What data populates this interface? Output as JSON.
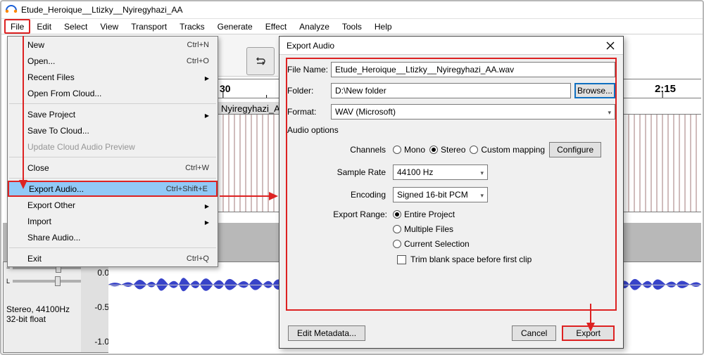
{
  "window_title": "Etude_Heroique__Ltizky__Nyiregyhazi_AA",
  "menubar": [
    "File",
    "Edit",
    "Select",
    "View",
    "Transport",
    "Tracks",
    "Generate",
    "Effect",
    "Analyze",
    "Tools",
    "Help"
  ],
  "file_menu": {
    "new": {
      "label": "New",
      "shortcut": "Ctrl+N"
    },
    "open": {
      "label": "Open...",
      "shortcut": "Ctrl+O"
    },
    "recent": {
      "label": "Recent Files"
    },
    "open_cloud": {
      "label": "Open From Cloud..."
    },
    "save_project": {
      "label": "Save Project"
    },
    "save_cloud": {
      "label": "Save To Cloud..."
    },
    "update_cloud": {
      "label": "Update Cloud Audio Preview"
    },
    "close": {
      "label": "Close",
      "shortcut": "Ctrl+W"
    },
    "export_audio": {
      "label": "Export Audio...",
      "shortcut": "Ctrl+Shift+E"
    },
    "export_other": {
      "label": "Export Other"
    },
    "import": {
      "label": "Import"
    },
    "share": {
      "label": "Share Audio..."
    },
    "exit": {
      "label": "Exit",
      "shortcut": "Ctrl+Q"
    }
  },
  "ruler": {
    "t1": "30",
    "t2": "2:15"
  },
  "track_suffix": "Nyiregyhazi_AA",
  "left_panel": {
    "info_line1": "Stereo, 44100Hz",
    "info_line2": "32-bit float",
    "scale": [
      "0.0",
      "-0.5",
      "-1.0"
    ]
  },
  "dialog": {
    "title": "Export Audio",
    "filename_label": "File Name:",
    "filename_value": "Etude_Heroique__Ltizky__Nyiregyhazi_AA.wav",
    "folder_label": "Folder:",
    "folder_value": "D:\\New folder",
    "browse": "Browse...",
    "format_label": "Format:",
    "format_value": "WAV (Microsoft)",
    "audio_options": "Audio options",
    "channels_label": "Channels",
    "mono": "Mono",
    "stereo": "Stereo",
    "custom": "Custom mapping",
    "configure": "Configure",
    "samplerate_label": "Sample Rate",
    "samplerate_value": "44100 Hz",
    "encoding_label": "Encoding",
    "encoding_value": "Signed 16-bit PCM",
    "range_label": "Export Range:",
    "entire": "Entire Project",
    "multiple": "Multiple Files",
    "current": "Current Selection",
    "trim": "Trim blank space before first clip",
    "edit_meta": "Edit Metadata...",
    "cancel": "Cancel",
    "export": "Export"
  }
}
